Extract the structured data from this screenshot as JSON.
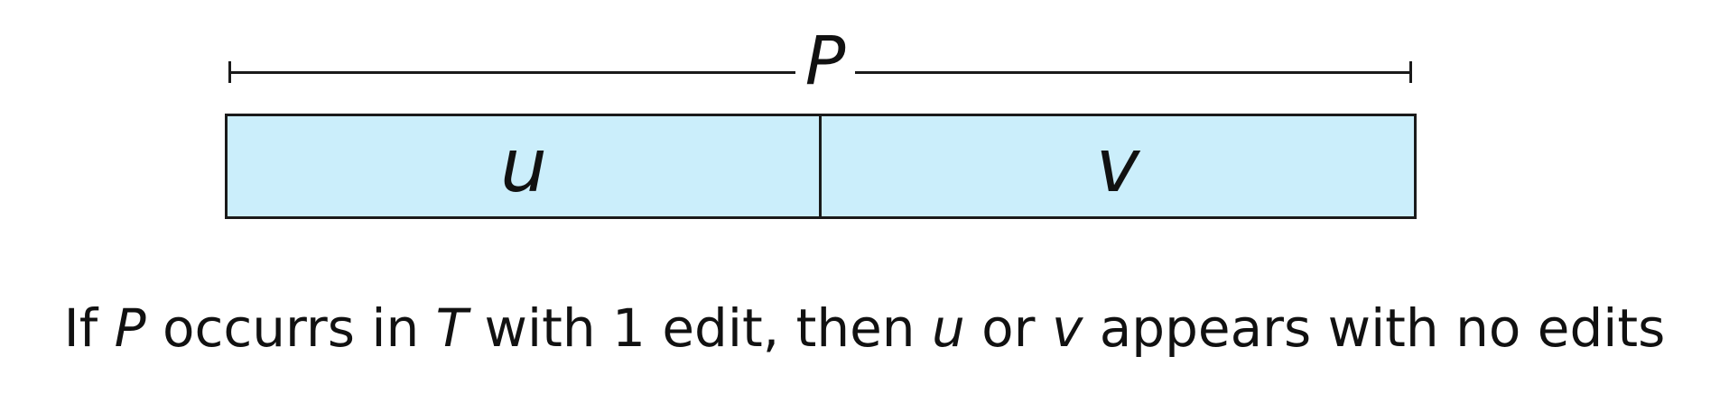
{
  "span": {
    "label": "P"
  },
  "segments": [
    {
      "label": "u"
    },
    {
      "label": "v"
    }
  ],
  "caption": {
    "parts": [
      {
        "text": "If ",
        "italic": false
      },
      {
        "text": "P",
        "italic": true
      },
      {
        "text": " occurrs in ",
        "italic": false
      },
      {
        "text": "T",
        "italic": true
      },
      {
        "text": " with 1 edit, then ",
        "italic": false
      },
      {
        "text": "u",
        "italic": true
      },
      {
        "text": " or ",
        "italic": false
      },
      {
        "text": "v",
        "italic": true
      },
      {
        "text": " appears with no edits",
        "italic": false
      }
    ]
  },
  "colors": {
    "segment_fill": "#cbeefb",
    "stroke": "#1a1a1a"
  }
}
